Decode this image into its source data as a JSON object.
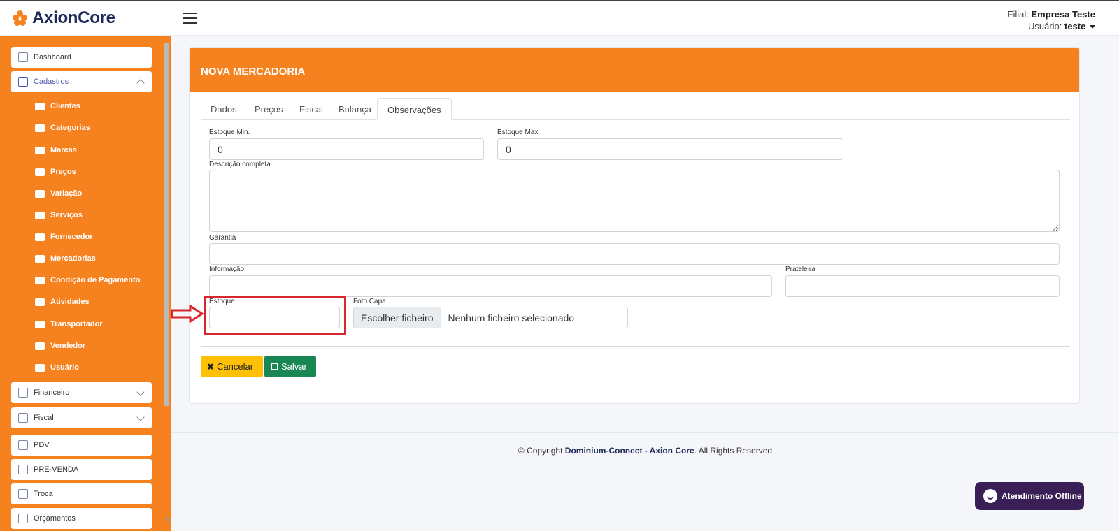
{
  "header": {
    "brand": "AxionCore",
    "filial_label": "Filial:",
    "filial_value": "Empresa Teste",
    "usuario_label": "Usuário:",
    "usuario_value": "teste"
  },
  "sidebar": {
    "dashboard": "Dashboard",
    "cadastros": "Cadastros",
    "cadastros_items": [
      "Clientes",
      "Categorias",
      "Marcas",
      "Preços",
      "Variação",
      "Serviços",
      "Fornecedor",
      "Mercadorias",
      "Condição de Pagamento",
      "Atividades",
      "Transportador",
      "Vendedor",
      "Usuário"
    ],
    "financeiro": "Financeiro",
    "fiscal": "Fiscal",
    "pdv": "PDV",
    "pre_venda": "PRE-VENDA",
    "troca": "Troca",
    "orcamentos": "Orçamentos"
  },
  "page": {
    "title": "NOVA MERCADORIA",
    "tabs": [
      "Dados",
      "Preços",
      "Fiscal",
      "Balança",
      "Observações"
    ],
    "active_tab": "Observações"
  },
  "form": {
    "estoque_min_label": "Estoque Min.",
    "estoque_min_value": "0",
    "estoque_max_label": "Estoque Max.",
    "estoque_max_value": "0",
    "descricao_label": "Descrição completa",
    "garantia_label": "Garantia",
    "informacao_label": "Informação",
    "prateleira_label": "Prateleira",
    "estoque_label": "Estoque",
    "foto_label": "Foto Capa",
    "file_button": "Escolher ficheiro",
    "file_status": "Nenhum ficheiro selecionado",
    "cancel": "Cancelar",
    "save": "Salvar"
  },
  "footer": {
    "prefix": "© Copyright",
    "brand": "Dominium-Connect - Axion Core",
    "suffix": ". All Rights Reserved"
  },
  "chat": {
    "label": "Atendimento Offline"
  },
  "colors": {
    "primary_orange": "#f5821f",
    "save_green": "#198754",
    "cancel_yellow": "#ffc107",
    "highlight_red": "#d9262c",
    "chat_purple": "#3a1f57"
  }
}
